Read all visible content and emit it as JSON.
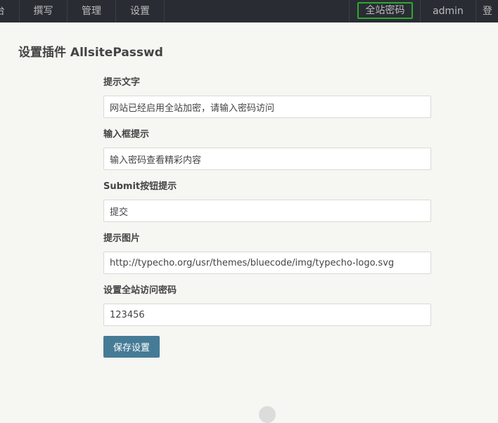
{
  "nav": {
    "left": [
      "台",
      "撰写",
      "管理",
      "设置"
    ],
    "right": {
      "highlight": "全站密码",
      "user": "admin",
      "logout": "登"
    },
    "highlight_color": "#2fa82f"
  },
  "page": {
    "title": "设置插件 AllsitePasswd"
  },
  "form": {
    "fields": [
      {
        "label": "提示文字",
        "value": "网站已经启用全站加密，请输入密码访问"
      },
      {
        "label": "输入框提示",
        "value": "输入密码查看精彩内容"
      },
      {
        "label": "Submit按钮提示",
        "value": "提交"
      },
      {
        "label": "提示图片",
        "value": "http://typecho.org/usr/themes/bluecode/img/typecho-logo.svg"
      },
      {
        "label": "设置全站访问密码",
        "value": "123456"
      }
    ],
    "submit_label": "保存设置"
  },
  "colors": {
    "topbar": "#292d33",
    "button": "#467b96",
    "background": "#f6f6f3"
  }
}
